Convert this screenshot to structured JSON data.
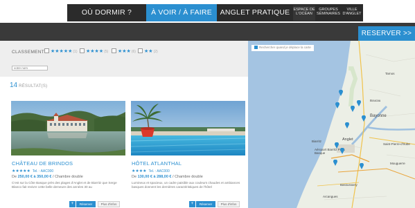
{
  "nav": {
    "where_to_sleep": "OÙ DORMIR ?",
    "see_and_do": "À VOIR / À FAIRE",
    "practical": "ANGLET PRATIQUE",
    "small_items": [
      {
        "line1": "ESPACE DE",
        "line2": "L'OCÉAN"
      },
      {
        "line1": "GROUPES",
        "line2": "SÉMINAIRES"
      },
      {
        "line1": "VILLE",
        "line2": "D'ANGLET"
      }
    ]
  },
  "reserve_label": "RESERVER >>",
  "filters": {
    "label": "CLASSEMENT",
    "options": [
      {
        "stars": "★★★★★",
        "count": "(1)"
      },
      {
        "stars": "★★★★",
        "count": "(5)"
      },
      {
        "stars": "★★★",
        "count": "(6)"
      },
      {
        "stars": "★★",
        "count": "(2)"
      }
    ],
    "search_placeholder": "votre nom"
  },
  "results": {
    "count": "14",
    "label": "RÉSULTAT(S)"
  },
  "cards": [
    {
      "title": "CHÂTEAU DE BRINDOS",
      "stars": "★★★★★",
      "tel": "Tel. : AAC000",
      "price_prefix": "De ",
      "price": "250,00 € à 350,00 €",
      "price_suffix": " / Chambre double",
      "desc": "C'est sur la Côte Basque près des plages d'Anglet et de Biarritz que Serge Blanco fait revivre cette belle demeure des années 30 au",
      "book": "Réserver",
      "info": "Plus d'infos"
    },
    {
      "title": "HÔTEL ATLANTHAL",
      "stars": "★★★★",
      "tel": "Tel. : AAC000",
      "price_prefix": "De ",
      "price": "130,00 € à 288,00 €",
      "price_suffix": " / Chambre double",
      "desc": "Lumineux et spacieux, un cadre paisible aux couleurs chaudes et ambiances basques donnent les dernières caractéristiques de l'hôtel",
      "book": "Réserver",
      "info": "Plus d'infos"
    }
  ],
  "map": {
    "checkbox_label": "Rechercher quand je déplace la carte",
    "labels": [
      "Tarnos",
      "Boucau",
      "Bayonne",
      "Biarritz",
      "Anglet",
      "Aéroport Biarritz Pays Basque",
      "Saint-Pierre-d'Irube",
      "Mouguerre",
      "Bassussarry",
      "Arcangues"
    ]
  },
  "colors": {
    "accent": "#2b8fd0",
    "dark_nav": "#2b2b2b",
    "band": "#3a3a3a",
    "sea": "#a4c4e2",
    "land": "#ecefe6"
  }
}
